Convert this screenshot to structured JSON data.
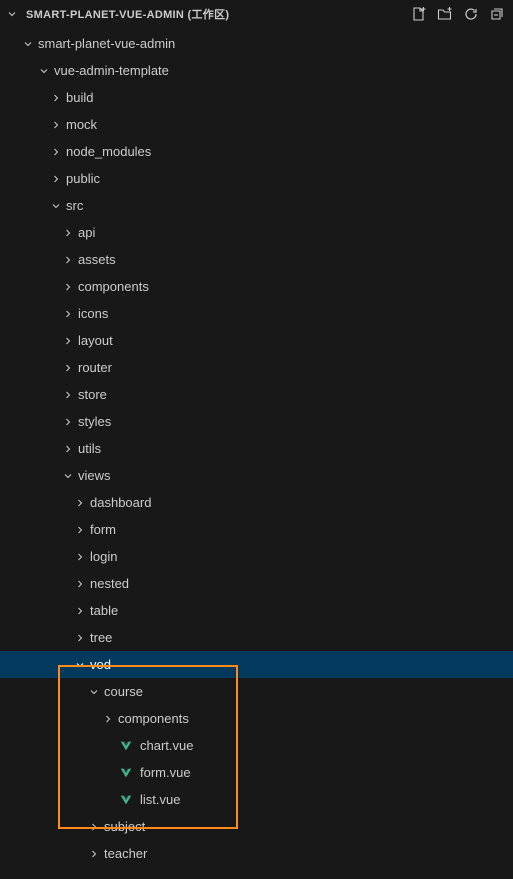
{
  "header": {
    "title": "SMART-PLANET-VUE-ADMIN (工作区)"
  },
  "tree": {
    "n0": "smart-planet-vue-admin",
    "n1": "vue-admin-template",
    "n2": "build",
    "n3": "mock",
    "n4": "node_modules",
    "n5": "public",
    "n6": "src",
    "n7": "api",
    "n8": "assets",
    "n9": "components",
    "n10": "icons",
    "n11": "layout",
    "n12": "router",
    "n13": "store",
    "n14": "styles",
    "n15": "utils",
    "n16": "views",
    "n17": "dashboard",
    "n18": "form",
    "n19": "login",
    "n20": "nested",
    "n21": "table",
    "n22": "tree",
    "n23": "vod",
    "n24": "course",
    "n25": "components",
    "n26": "chart.vue",
    "n27": "form.vue",
    "n28": "list.vue",
    "n29": "subject",
    "n30": "teacher"
  }
}
